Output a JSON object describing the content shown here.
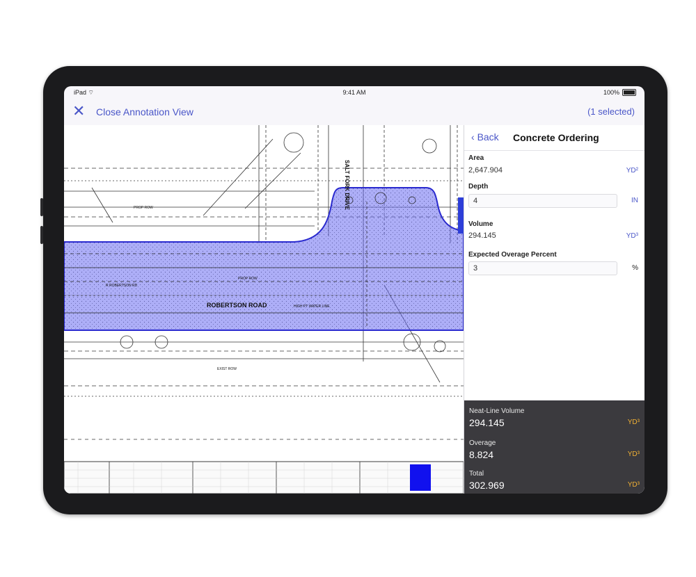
{
  "status_bar": {
    "left": "iPad ⌔",
    "time": "9:41 AM",
    "battery": "100%"
  },
  "nav": {
    "close_label": "Close Annotation View",
    "selected": "(1 selected)"
  },
  "panel": {
    "back_label": "Back",
    "title": "Concrete Ordering",
    "fields": {
      "area": {
        "label": "Area",
        "value": "2,647.904",
        "unit": "YD²"
      },
      "depth": {
        "label": "Depth",
        "value": "4",
        "unit": "IN"
      },
      "volume": {
        "label": "Volume",
        "value": "294.145",
        "unit": "YD³"
      },
      "overage": {
        "label": "Expected Overage Percent",
        "value": "3",
        "unit": "%"
      }
    },
    "summary": {
      "neat": {
        "label": "Neat-Line Volume",
        "value": "294.145",
        "unit": "YD³"
      },
      "overage": {
        "label": "Overage",
        "value": "8.824",
        "unit": "YD³"
      },
      "total": {
        "label": "Total",
        "value": "302.969",
        "unit": "YD³"
      }
    }
  },
  "drawing": {
    "road_label": "ROBERTSON ROAD",
    "street_label": "SALT FORK DRIVE",
    "annotations": [
      "PROP ROW",
      "EXIST ROW",
      "R ROBERTSON RD",
      "HIGH PT WATER LINE",
      "PROP ROW"
    ],
    "highlight_color": "#5e60e6",
    "accent_color": "#4a56c8"
  }
}
